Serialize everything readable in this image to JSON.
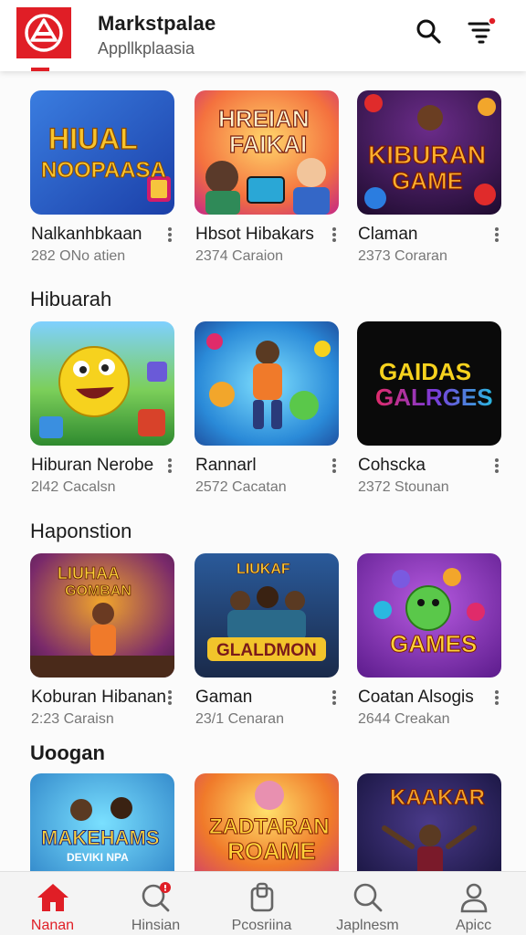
{
  "app": {
    "title": "Markstpalae",
    "subtitle": "Appllkplaasia",
    "brand_color": "#e01e26"
  },
  "header": {
    "search_icon": "search-icon",
    "filter_icon": "filter-icon"
  },
  "rows": [
    {
      "section_title": null,
      "cards": [
        {
          "name": "Nalkanhbkaan",
          "meta": "282 ONo atien",
          "thumb_text": [
            "HIUAL",
            "NOOPAASA"
          ]
        },
        {
          "name": "Hbsot Hibakars",
          "meta": "2374 Caraion",
          "thumb_text": [
            "HREIAN",
            "FAIKAI"
          ]
        },
        {
          "name": "Claman",
          "meta": "2373 Coraran",
          "thumb_text": [
            "KIBURAN",
            "GAME"
          ]
        }
      ]
    },
    {
      "section_title": "Hibuarah",
      "cards": [
        {
          "name": "Hiburan Nerobe",
          "meta": "2l42 Cacalsn",
          "thumb_text": []
        },
        {
          "name": "Rannarl",
          "meta": "2572 Cacatan",
          "thumb_text": []
        },
        {
          "name": "Cohscka",
          "meta": "2372 Stounan",
          "thumb_text": [
            "GAIDAS",
            "GALRGES"
          ]
        }
      ]
    },
    {
      "section_title": "Haponstion",
      "cards": [
        {
          "name": "Koburan Hibanan",
          "meta": "2:23 Caraisn",
          "thumb_text": [
            "LIUHAA",
            "GOMBAN"
          ]
        },
        {
          "name": "Gaman",
          "meta": "23/1 Cenaran",
          "thumb_text": [
            "LIUKAF",
            "GLALDMON"
          ]
        },
        {
          "name": "Coatan Alsogis",
          "meta": "2644 Creakan",
          "thumb_text": [
            "GAMES"
          ]
        }
      ]
    },
    {
      "section_title": "Uoogan",
      "cards": [
        {
          "name": "",
          "meta": "",
          "thumb_text": [
            "MAKEHAMS",
            "DEVIKI NPA"
          ]
        },
        {
          "name": "",
          "meta": "",
          "thumb_text": [
            "ZADTARAN",
            "ROAME"
          ]
        },
        {
          "name": "",
          "meta": "",
          "thumb_text": [
            "KAAKAR"
          ]
        }
      ]
    }
  ],
  "bottom_nav": [
    {
      "label": "Nanan",
      "icon": "home-icon",
      "active": true
    },
    {
      "label": "Hinsian",
      "icon": "notification-search-icon",
      "active": false
    },
    {
      "label": "Pcosriina",
      "icon": "bag-icon",
      "active": false
    },
    {
      "label": "Japlnesm",
      "icon": "search-icon",
      "active": false
    },
    {
      "label": "Apicc",
      "icon": "profile-icon",
      "active": false
    }
  ]
}
